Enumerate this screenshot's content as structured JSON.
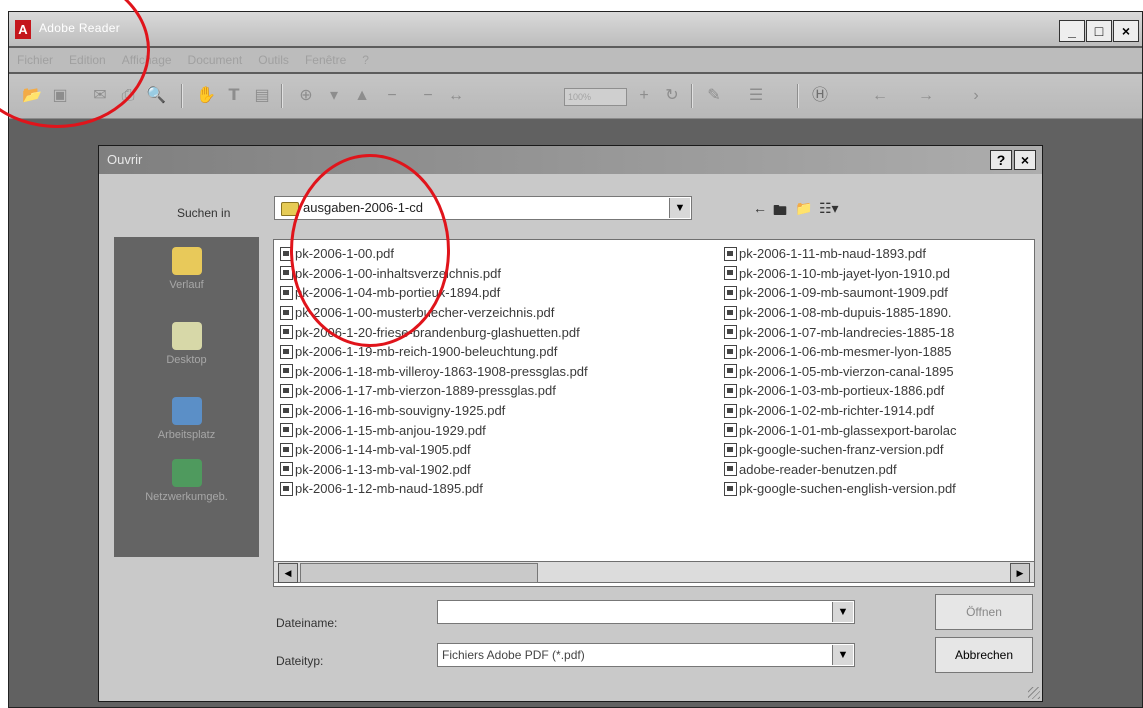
{
  "app": {
    "title": "Adobe Reader",
    "logo": "A",
    "window_buttons": [
      "_",
      "□",
      "×"
    ]
  },
  "menu": [
    "Fichier",
    "Edition",
    "Affichage",
    "Document",
    "Outils",
    "Fenêtre",
    "?"
  ],
  "toolbar": {
    "zoom": "100%"
  },
  "dialog": {
    "title": "Ouvrir",
    "help_button": "?",
    "close_button": "×",
    "look_in_label": "Suchen in",
    "look_in_value": "ausgaben-2006-1-cd",
    "places": [
      {
        "label": "Verlauf",
        "icon": "history-icon"
      },
      {
        "label": "Desktop",
        "icon": "desktop-icon"
      },
      {
        "label": "Arbeitsplatz",
        "icon": "my-computer-icon"
      },
      {
        "label": "Netzwerkumgeb.",
        "icon": "network-icon"
      }
    ],
    "files_col1": [
      "pk-2006-1-00.pdf",
      "pk-2006-1-00-inhaltsverzeichnis.pdf",
      "pk-2006-1-04-mb-portieux-1894.pdf",
      "pk-2006-1-00-musterbuecher-verzeichnis.pdf",
      "pk-2006-1-20-friese-brandenburg-glashuetten.pdf",
      "pk-2006-1-19-mb-reich-1900-beleuchtung.pdf",
      "pk-2006-1-18-mb-villeroy-1863-1908-pressglas.pdf",
      "pk-2006-1-17-mb-vierzon-1889-pressglas.pdf",
      "pk-2006-1-16-mb-souvigny-1925.pdf",
      "pk-2006-1-15-mb-anjou-1929.pdf",
      "pk-2006-1-14-mb-val-1905.pdf",
      "pk-2006-1-13-mb-val-1902.pdf",
      "pk-2006-1-12-mb-naud-1895.pdf"
    ],
    "files_col2": [
      "pk-2006-1-11-mb-naud-1893.pdf",
      "pk-2006-1-10-mb-jayet-lyon-1910.pd",
      "pk-2006-1-09-mb-saumont-1909.pdf",
      "pk-2006-1-08-mb-dupuis-1885-1890.",
      "pk-2006-1-07-mb-landrecies-1885-18",
      "pk-2006-1-06-mb-mesmer-lyon-1885",
      "pk-2006-1-05-mb-vierzon-canal-1895",
      "pk-2006-1-03-mb-portieux-1886.pdf",
      "pk-2006-1-02-mb-richter-1914.pdf",
      "pk-2006-1-01-mb-glassexport-barolac",
      "pk-google-suchen-franz-version.pdf",
      "adobe-reader-benutzen.pdf",
      "pk-google-suchen-english-version.pdf"
    ],
    "filename_label": "Dateiname:",
    "filename_value": "",
    "filetype_label": "Dateityp:",
    "filetype_value": "Fichiers Adobe PDF (*.pdf)",
    "open_button": "Öffnen",
    "cancel_button": "Abbrechen"
  },
  "colors": {
    "annotation": "#e0141b",
    "logo": "#c4161c"
  }
}
